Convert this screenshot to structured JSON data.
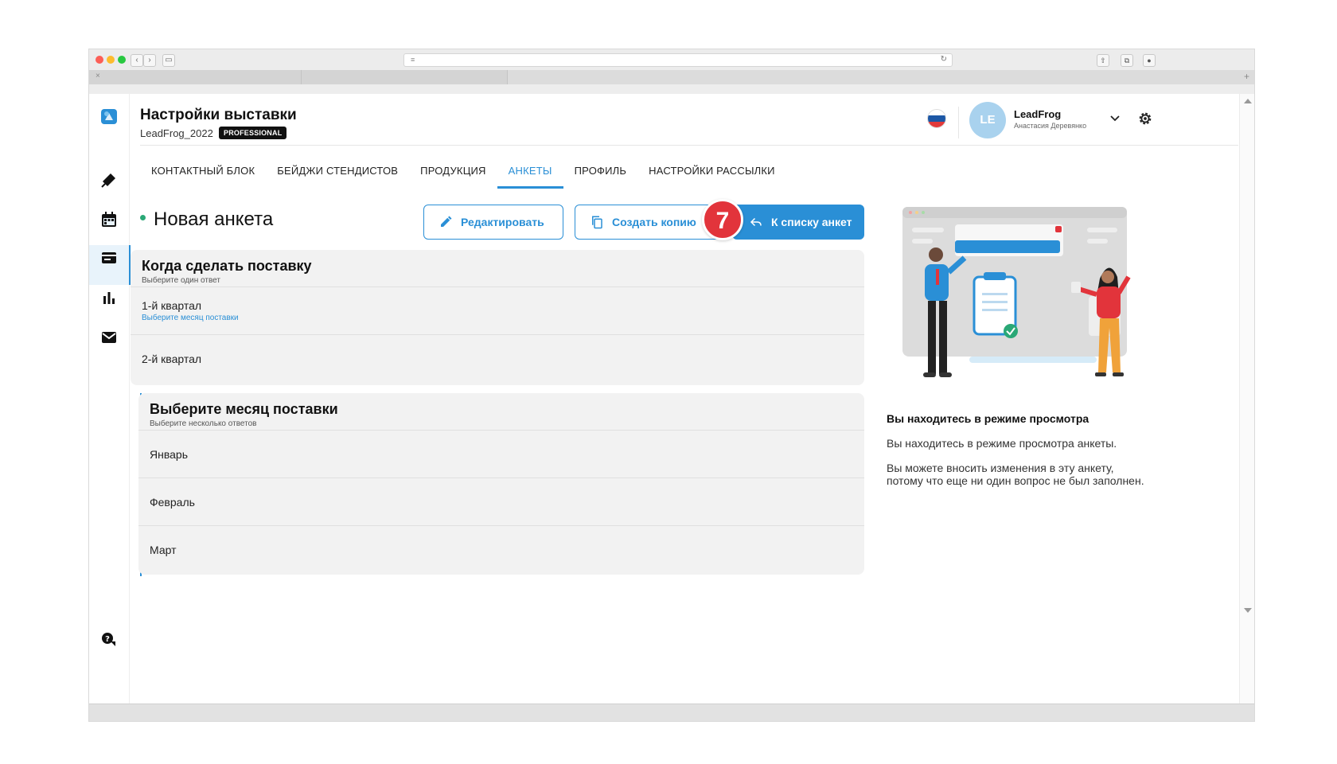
{
  "browser": {
    "tab_close": "×",
    "tab_plus": "+"
  },
  "header": {
    "title": "Настройки выставки",
    "subtitle": "LeadFrog_2022",
    "badge": "PROFESSIONAL",
    "user_initials": "LE",
    "user_name": "LeadFrog",
    "user_sub": "Анастасия Деревянко"
  },
  "tabs": [
    {
      "label": "КОНТАКТНЫЙ БЛОК"
    },
    {
      "label": "БЕЙДЖИ СТЕНДИСТОВ"
    },
    {
      "label": "ПРОДУКЦИЯ"
    },
    {
      "label": "АНКЕТЫ"
    },
    {
      "label": "ПРОФИЛЬ"
    },
    {
      "label": "НАСТРОЙКИ РАССЫЛКИ"
    }
  ],
  "form": {
    "title": "Новая анкета",
    "edit_label": "Редактировать",
    "copy_label": "Создать копию",
    "back_label": "К списку анкет",
    "step_number": "7"
  },
  "questions": [
    {
      "title": "Когда сделать поставку",
      "subtitle": "Выберите один ответ",
      "options": [
        {
          "label": "1-й квартал",
          "link": "Выберите месяц поставки"
        },
        {
          "label": "2-й квартал"
        }
      ]
    },
    {
      "title": "Выберите месяц поставки",
      "subtitle": "Выберите несколько ответов",
      "options": [
        {
          "label": "Январь"
        },
        {
          "label": "Февраль"
        },
        {
          "label": "Март"
        }
      ]
    }
  ],
  "panel": {
    "title": "Вы находитесь в режиме просмотра",
    "text1": "Вы находитесь в режиме просмотра анкеты.",
    "text2": "Вы можете вносить изменения в эту анкету, потому что еще ни один вопрос не был заполнен."
  },
  "colors": {
    "accent": "#2a8fd6",
    "badge_red": "#e2343b",
    "status_green": "#2aa876"
  }
}
